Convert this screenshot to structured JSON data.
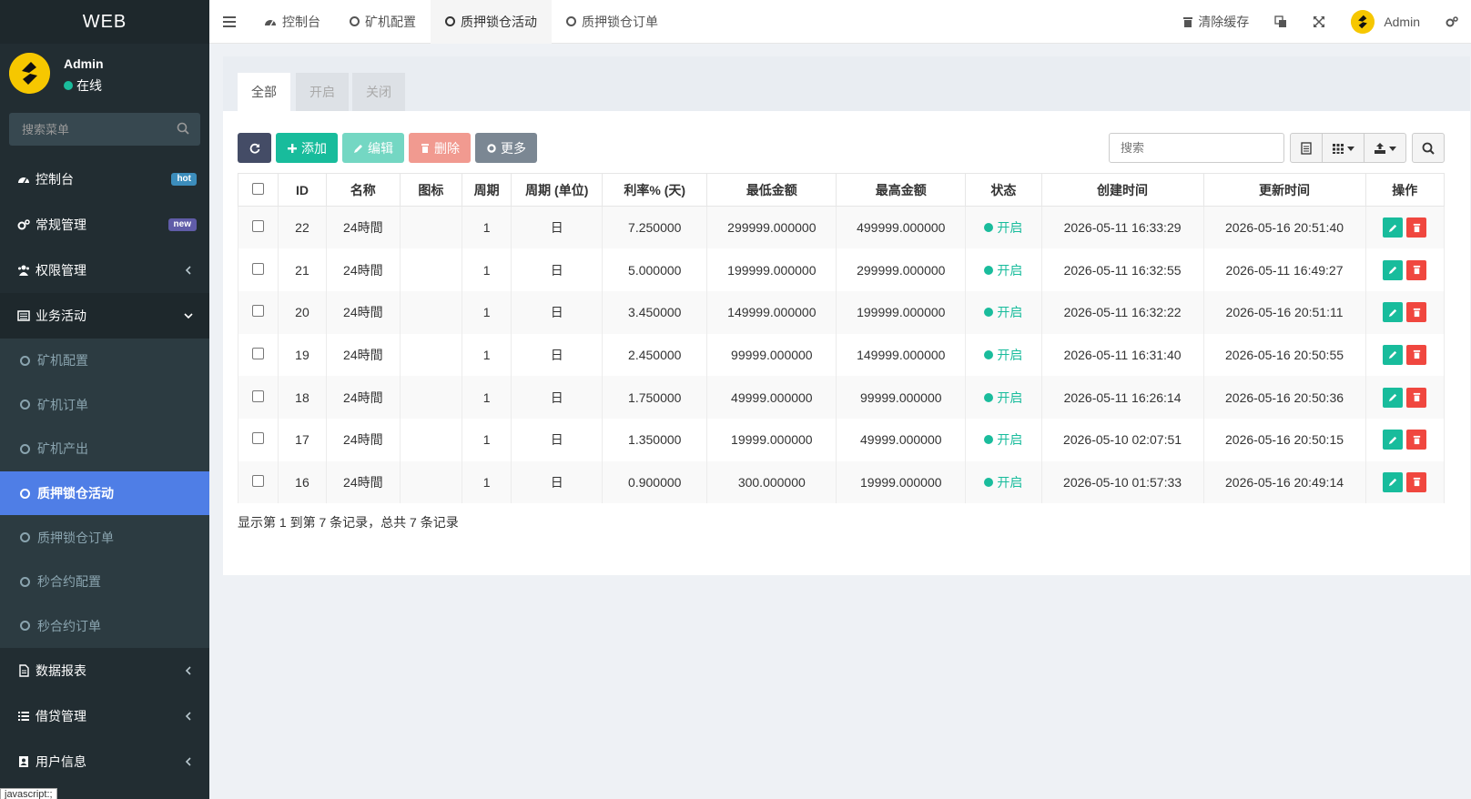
{
  "sidebar": {
    "brand": "WEB",
    "user": {
      "name": "Admin",
      "status": "在线"
    },
    "search_placeholder": "搜索菜单",
    "items": [
      {
        "label": "控制台",
        "icon": "dashboard-icon",
        "badge": "hot",
        "badge_color": "#3c8dbc"
      },
      {
        "label": "常规管理",
        "icon": "cogs-icon",
        "badge": "new",
        "badge_color": "#605ca8"
      },
      {
        "label": "权限管理",
        "icon": "group-icon"
      },
      {
        "label": "业务活动",
        "icon": "list-alt-icon"
      },
      {
        "label": "数据报表",
        "icon": "file-icon"
      },
      {
        "label": "借贷管理",
        "icon": "list-icon"
      },
      {
        "label": "用户信息",
        "icon": "address-book-icon"
      }
    ],
    "sub_items": [
      {
        "label": "矿机配置"
      },
      {
        "label": "矿机订单"
      },
      {
        "label": "矿机产出"
      },
      {
        "label": "质押锁仓活动"
      },
      {
        "label": "质押锁仓订单"
      },
      {
        "label": "秒合约配置"
      },
      {
        "label": "秒合约订单"
      }
    ],
    "status_bar_text": "javascript:;"
  },
  "header": {
    "tabs": [
      {
        "label": "控制台"
      },
      {
        "label": "矿机配置"
      },
      {
        "label": "质押锁仓活动"
      },
      {
        "label": "质押锁仓订单"
      }
    ],
    "clear_cache": "清除缓存",
    "admin": "Admin"
  },
  "panel": {
    "tabs": [
      "全部",
      "开启",
      "关闭"
    ],
    "toolbar": {
      "add": "添加",
      "edit": "编辑",
      "delete": "删除",
      "more": "更多"
    },
    "search_placeholder": "搜索",
    "columns": [
      "ID",
      "名称",
      "图标",
      "周期",
      "周期 (单位)",
      "利率% (天)",
      "最低金额",
      "最高金额",
      "状态",
      "创建时间",
      "更新时间",
      "操作"
    ],
    "rows": [
      {
        "id": "22",
        "name": "24時間",
        "icon": "",
        "period": "1",
        "unit": "日",
        "rate": "7.250000",
        "min": "299999.000000",
        "max": "499999.000000",
        "status": "开启",
        "created": "2026-05-11 16:33:29",
        "updated": "2026-05-16 20:51:40"
      },
      {
        "id": "21",
        "name": "24時間",
        "icon": "",
        "period": "1",
        "unit": "日",
        "rate": "5.000000",
        "min": "199999.000000",
        "max": "299999.000000",
        "status": "开启",
        "created": "2026-05-11 16:32:55",
        "updated": "2026-05-11 16:49:27"
      },
      {
        "id": "20",
        "name": "24時間",
        "icon": "",
        "period": "1",
        "unit": "日",
        "rate": "3.450000",
        "min": "149999.000000",
        "max": "199999.000000",
        "status": "开启",
        "created": "2026-05-11 16:32:22",
        "updated": "2026-05-16 20:51:11"
      },
      {
        "id": "19",
        "name": "24時間",
        "icon": "",
        "period": "1",
        "unit": "日",
        "rate": "2.450000",
        "min": "99999.000000",
        "max": "149999.000000",
        "status": "开启",
        "created": "2026-05-11 16:31:40",
        "updated": "2026-05-16 20:50:55"
      },
      {
        "id": "18",
        "name": "24時間",
        "icon": "",
        "period": "1",
        "unit": "日",
        "rate": "1.750000",
        "min": "49999.000000",
        "max": "99999.000000",
        "status": "开启",
        "created": "2026-05-11 16:26:14",
        "updated": "2026-05-16 20:50:36"
      },
      {
        "id": "17",
        "name": "24時間",
        "icon": "",
        "period": "1",
        "unit": "日",
        "rate": "1.350000",
        "min": "19999.000000",
        "max": "49999.000000",
        "status": "开启",
        "created": "2026-05-10 02:07:51",
        "updated": "2026-05-16 20:50:15"
      },
      {
        "id": "16",
        "name": "24時間",
        "icon": "",
        "period": "1",
        "unit": "日",
        "rate": "0.900000",
        "min": "300.000000",
        "max": "19999.000000",
        "status": "开启",
        "created": "2026-05-10 01:57:33",
        "updated": "2026-05-16 20:49:14"
      }
    ],
    "footer": "显示第 1 到第 7 条记录，总共 7 条记录"
  },
  "colors": {
    "sidebar": "#222d32",
    "active_menu": "#4f7ee6",
    "green": "#18bc9c",
    "red": "#f0473f",
    "logo": "#f6c700"
  }
}
